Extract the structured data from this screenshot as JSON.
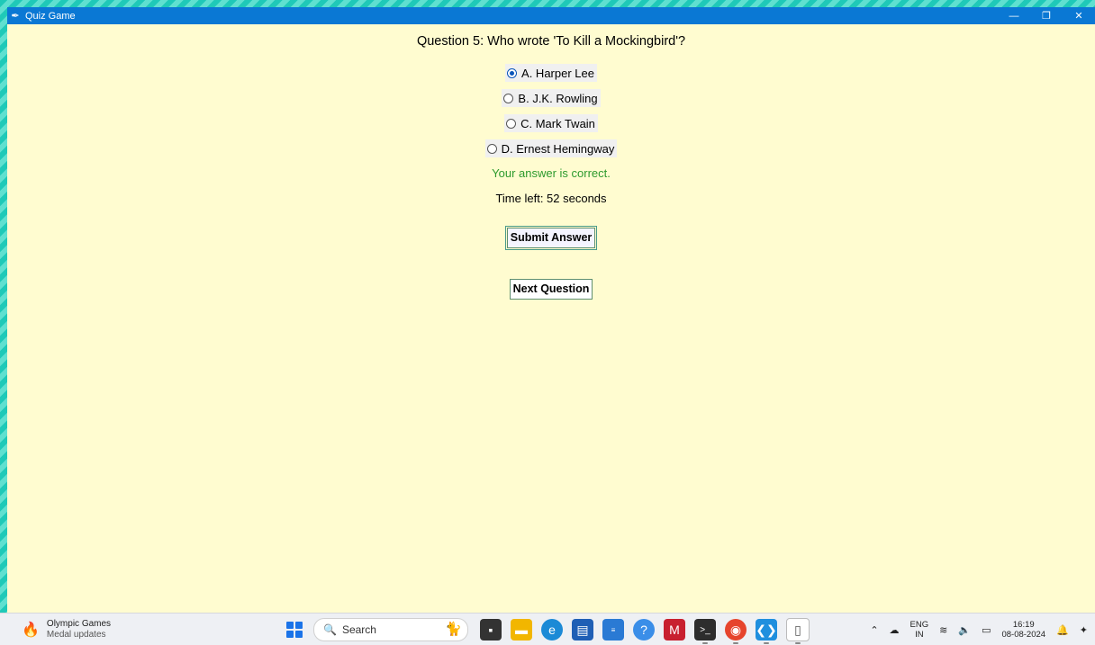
{
  "window": {
    "title": "Quiz Game"
  },
  "quiz": {
    "question": "Question 5: Who wrote 'To Kill a Mockingbird'?",
    "options": [
      {
        "label": "A. Harper Lee",
        "selected": true
      },
      {
        "label": "B. J.K. Rowling",
        "selected": false
      },
      {
        "label": "C. Mark Twain",
        "selected": false
      },
      {
        "label": "D. Ernest Hemingway",
        "selected": false
      }
    ],
    "feedback": "Your answer is correct.",
    "timer": "Time left: 52 seconds",
    "submit_label": "Submit Answer",
    "next_label": "Next Question"
  },
  "colors": {
    "feedback": "#2d9a2d",
    "background": "#fffcd0",
    "titlebar": "#0a78d4"
  },
  "taskbar": {
    "widget_title": "Olympic Games",
    "widget_subtitle": "Medal updates",
    "search_label": "Search",
    "lang_top": "ENG",
    "lang_bottom": "IN",
    "time": "16:19",
    "date": "08-08-2024"
  }
}
